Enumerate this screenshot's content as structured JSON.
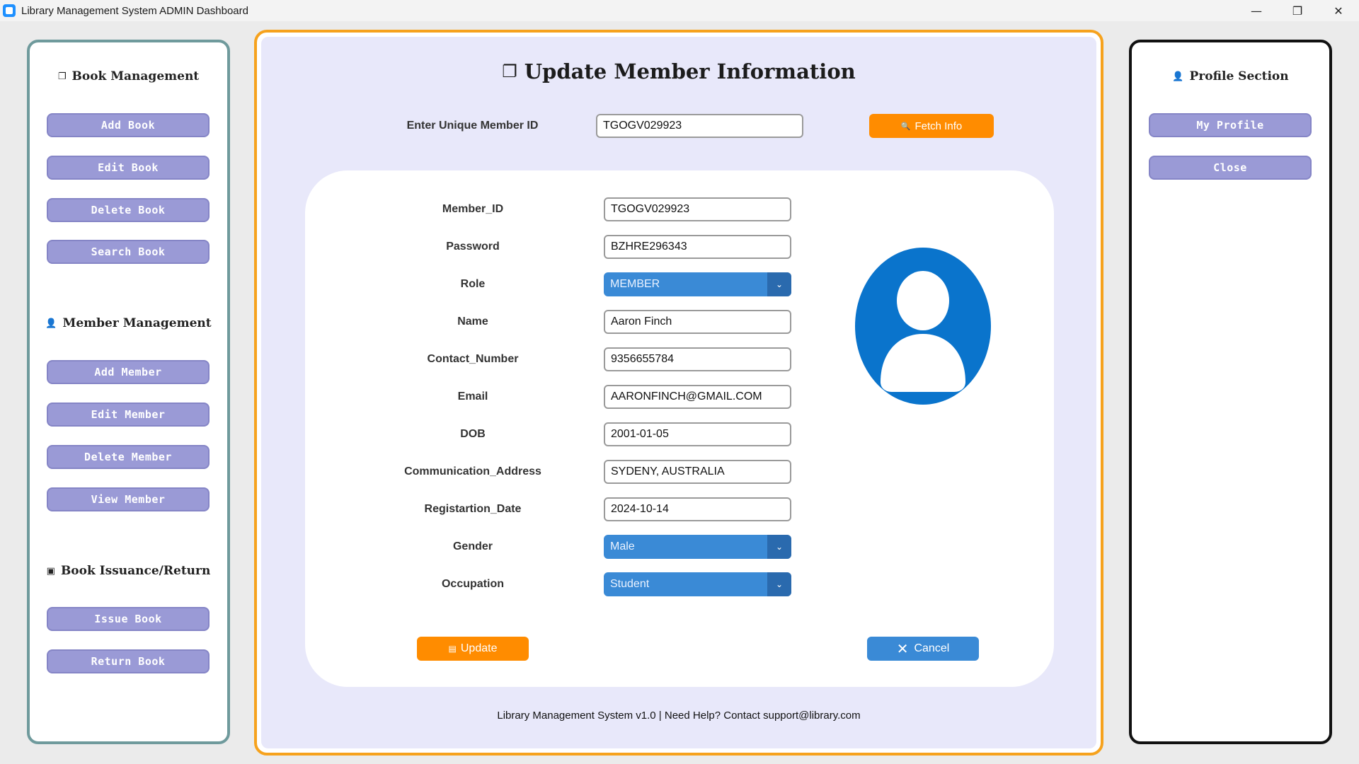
{
  "window": {
    "title": "Library Management System ADMIN Dashboard",
    "minimize_glyph": "—",
    "restore_glyph": "❐",
    "close_glyph": "✕"
  },
  "sidebar_left": {
    "book_section": {
      "icon": "books-icon",
      "title": "Book Management",
      "buttons": [
        "Add Book",
        "Edit Book",
        "Delete Book",
        "Search Book"
      ]
    },
    "member_section": {
      "icon": "person-icon",
      "title": "Member Management",
      "buttons": [
        "Add Member",
        "Edit Member",
        "Delete Member",
        "View Member"
      ]
    },
    "issuance_section": {
      "icon": "calendar-icon",
      "title": "Book Issuance/Return",
      "buttons": [
        "Issue Book",
        "Return Book"
      ]
    }
  },
  "sidebar_right": {
    "icon": "person-icon",
    "title": "Profile Section",
    "buttons": [
      "My Profile",
      "Close"
    ]
  },
  "main": {
    "title": "Update Member Information",
    "title_icon": "books-icon",
    "lookup": {
      "label": "Enter Unique Member ID",
      "value": "TGOGV029923",
      "fetch_label": "Fetch Info",
      "fetch_icon": "magnifier-icon"
    },
    "form": {
      "member_id": {
        "label": "Member_ID",
        "value": "TGOGV029923"
      },
      "password": {
        "label": "Password",
        "value": "BZHRE296343"
      },
      "role": {
        "label": "Role",
        "value": "MEMBER"
      },
      "name": {
        "label": "Name",
        "value": "Aaron Finch"
      },
      "contact": {
        "label": "Contact_Number",
        "value": "9356655784"
      },
      "email": {
        "label": "Email",
        "value": "AARONFINCH@GMAIL.COM"
      },
      "dob": {
        "label": "DOB",
        "value": "2001-01-05"
      },
      "address": {
        "label": "Communication_Address",
        "value": "SYDENY, AUSTRALIA"
      },
      "reg_date": {
        "label": "Registartion_Date",
        "value": "2024-10-14"
      },
      "gender": {
        "label": "Gender",
        "value": "Male"
      },
      "occupation": {
        "label": "Occupation",
        "value": "Student"
      }
    },
    "update_label": "Update",
    "update_icon": "save-icon",
    "cancel_label": "Cancel",
    "cancel_icon": "x-icon",
    "footer": "Library Management System v1.0 | Need Help? Contact support@library.com"
  },
  "colors": {
    "accent_orange": "#ff8c00",
    "accent_blue": "#3a8ad6",
    "nav_button": "#9a9ad6",
    "avatar_blue": "#0a74cc"
  }
}
